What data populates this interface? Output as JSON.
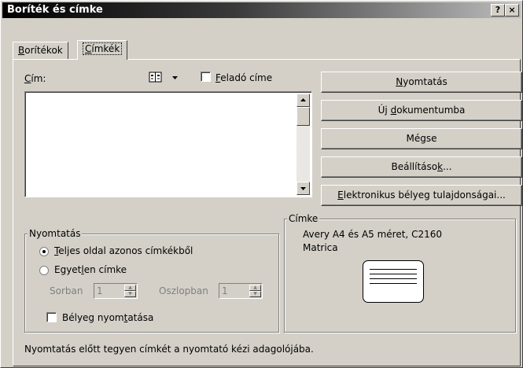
{
  "window": {
    "title": "Boríték és címke",
    "help_label": "?",
    "close_label": "×"
  },
  "tabs": [
    {
      "label": "Borítékok",
      "underline": "B",
      "rest": "orítékok",
      "active": false
    },
    {
      "label": "Címkék",
      "underline": "C",
      "rest": "ímkék",
      "active": true
    }
  ],
  "address": {
    "label_u": "C",
    "label_rest": "ím:",
    "book_icon": "address-book-icon",
    "sender_checkbox_u": "F",
    "sender_checkbox_rest": "eladó címe",
    "sender_checked": false,
    "value": ""
  },
  "buttons": {
    "print": {
      "u": "N",
      "rest": "yomtatás"
    },
    "new_doc": {
      "pre": "Új ",
      "u": "d",
      "rest": "okumentumba"
    },
    "cancel": {
      "text": "Mégse"
    },
    "options": {
      "pre": "Beállításo",
      "u": "k",
      "rest": "..."
    },
    "estamp": {
      "u": "E",
      "rest": "lektronikus bélyeg tulajdonságai..."
    }
  },
  "print_group": {
    "legend": "Nyomtatás",
    "full_page": {
      "u": "T",
      "rest": "eljes oldal azonos címkékből",
      "selected": true
    },
    "single": {
      "pre": "Egyet",
      "u": "l",
      "rest": "en címke",
      "selected": false
    },
    "row_label": "Sorban",
    "row_value": "1",
    "col_label": "Oszlopban",
    "col_value": "1",
    "stamp_print": {
      "pre": "Bélyeg nyom",
      "u": "t",
      "rest": "atása",
      "checked": false
    }
  },
  "label_group": {
    "legend": "Címke",
    "line1": "Avery A4 és A5 méret, C2160",
    "line2": "Matrica"
  },
  "status": "Nyomtatás előtt tegyen címkét a nyomtató kézi adagolójába."
}
